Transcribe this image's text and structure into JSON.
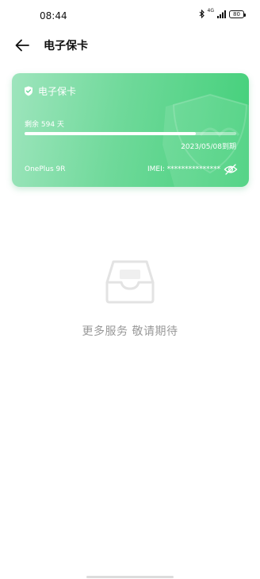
{
  "status_bar": {
    "time": "08:44",
    "network": "4G",
    "battery": "80"
  },
  "app_bar": {
    "title": "电子保卡",
    "back_icon": "arrow-left-icon"
  },
  "warranty_card": {
    "title": "电子保卡",
    "title_icon": "shield-icon",
    "remaining": "剩余 594 天",
    "progress_fraction": 0.81,
    "expire": "2023/05/08到期",
    "device": "OnePlus 9R",
    "imei": "IMEI: ***************",
    "visibility_icon": "eye-off-icon",
    "colors": {
      "start": "#9ee5bd",
      "end": "#43d07a"
    }
  },
  "empty_state": {
    "icon": "inbox-tray-icon",
    "text": "更多服务 敬请期待"
  }
}
